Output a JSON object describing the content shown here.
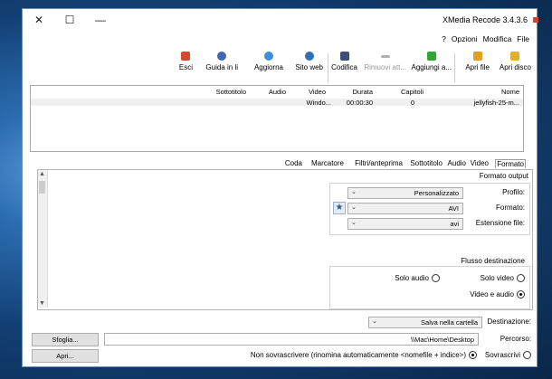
{
  "window": {
    "title": "XMedia Recode 3.4.3.6"
  },
  "menu": [
    "File",
    "Modifica",
    "Opzioni",
    "?"
  ],
  "toolbar": {
    "buttons": [
      {
        "label": "Apri disco",
        "icon": "disc-icon",
        "color": "#e0b030"
      },
      {
        "label": "Apri file",
        "icon": "folder-icon",
        "color": "#e0a020"
      },
      {
        "label": "Aggiungi a...",
        "icon": "plus-icon",
        "color": "#2fa832"
      },
      {
        "label": "Rimuovi att...",
        "icon": "minus-icon",
        "color": "#b0b0b0",
        "disabled": true
      },
      {
        "label": "Codifica",
        "icon": "encode-icon",
        "color": "#3c4f7a"
      },
      {
        "label": "Sito web",
        "icon": "globe-icon",
        "color": "#2f6fb8"
      },
      {
        "label": "Aggiorna",
        "icon": "refresh-icon",
        "color": "#3e8fd6"
      },
      {
        "label": "Guida in li",
        "icon": "help-icon",
        "color": "#3f67b3"
      },
      {
        "label": "Esci",
        "icon": "exit-icon",
        "color": "#d34b2a"
      }
    ]
  },
  "file_table": {
    "headers": [
      "Nome",
      "Capitoli",
      "Durata",
      "Video",
      "Audio",
      "Sottotitolo"
    ],
    "row": [
      "jellyfish-25-m...",
      "0",
      "00:00:30",
      "Windo...",
      "",
      ""
    ]
  },
  "tabs": [
    "Formato",
    "Video",
    "Audio",
    "Sottotitolo",
    "Filtri/anteprima",
    "Marcatore",
    "Coda"
  ],
  "format_panel": {
    "section": "Formato output",
    "profile_label": "Profilo:",
    "profile_value": "Personalizzato",
    "format_label": "Formato:",
    "format_value": "AVI",
    "extension_label": "Estensione file:",
    "extension_value": "avi",
    "stream_section": "Flusso destinazione",
    "radio_video_only": "Solo video",
    "radio_audio_only": "Solo audio",
    "radio_video_audio": "Video e audio"
  },
  "destination": {
    "label": "Destinazione:",
    "value": "Salva nella cartella",
    "path_label": "Percorso:",
    "path_value": "\\\\Mac\\Home\\Desktop",
    "browse": "Sfoglia...",
    "open": "Apri...",
    "overwrite": "Sovrascrivi",
    "no_overwrite": "Non sovrascrivere (rinomina automaticamente <nomefile + indice>)"
  }
}
